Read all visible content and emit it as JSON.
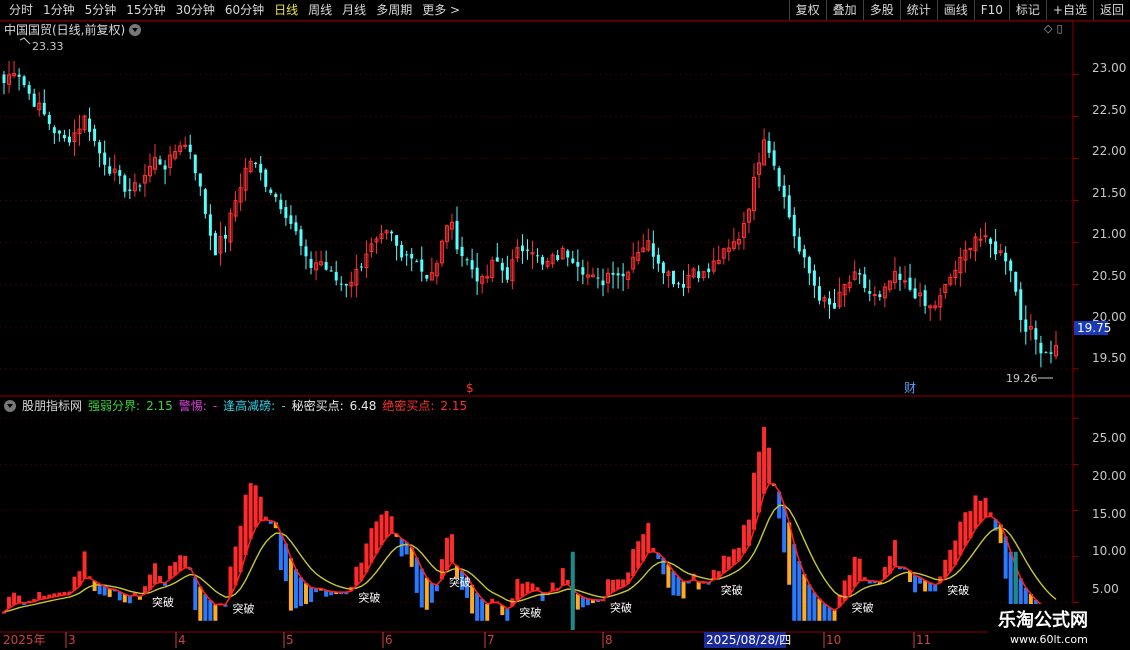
{
  "toolbar": {
    "periods": [
      "分时",
      "1分钟",
      "5分钟",
      "15分钟",
      "30分钟",
      "60分钟",
      "日线",
      "周线",
      "月线",
      "多周期",
      "更多 >"
    ],
    "active_period": "日线",
    "actions": [
      "复权",
      "叠加",
      "多股",
      "统计",
      "画线",
      "F10",
      "标记",
      "+自选",
      "返回"
    ]
  },
  "main_chart": {
    "title": "中国国贸(日线,前复权)",
    "high_label": "23.33",
    "low_label": "19.26",
    "current_price": "19.75",
    "y_ticks": [
      "23.00",
      "22.50",
      "22.00",
      "21.50",
      "21.00",
      "20.50",
      "20.00",
      "19.50"
    ],
    "ylim": [
      19.2,
      23.6
    ],
    "markers": {
      "dollar": "$",
      "cai": "财"
    }
  },
  "indicator": {
    "name": "股朋指标网",
    "fields": [
      {
        "label": "强弱分界:",
        "value": "2.15",
        "color": "#3cd23c"
      },
      {
        "label": "警惕:",
        "value": "-",
        "color": "#e040e0"
      },
      {
        "label": "逢高减磅:",
        "value": "-",
        "color": "#30d0e8"
      },
      {
        "label": "秘密买点:",
        "value": "6.48",
        "color": "#e8e8e8"
      },
      {
        "label": "绝密买点:",
        "value": "2.15",
        "color": "#ff3030"
      }
    ],
    "y_ticks": [
      "25.00",
      "20.00",
      "15.00",
      "10.00",
      "5.00"
    ],
    "ylim": [
      2.0,
      27.0
    ],
    "signal_text": "突破"
  },
  "date_axis": {
    "labels": [
      "2025年",
      "3",
      "4",
      "5",
      "6",
      "7",
      "8",
      "2025/08/28/四",
      "10",
      "11"
    ]
  },
  "watermark": {
    "line1": "乐淘公式网",
    "line2": "www.60lt.com"
  },
  "colors": {
    "up": "#ff3232",
    "down": "#54ffff",
    "grid": "#3a0000",
    "axis_border": "#8b0000"
  },
  "chart_data": {
    "type": "candlestick",
    "close_series": [
      22.9,
      23.1,
      22.8,
      22.6,
      22.4,
      22.2,
      22.3,
      22.5,
      22.1,
      21.9,
      21.7,
      21.6,
      21.8,
      22.0,
      21.9,
      22.2,
      22.1,
      21.5,
      20.9,
      21.1,
      21.6,
      22.0,
      21.8,
      21.6,
      21.4,
      21.1,
      20.7,
      20.8,
      20.6,
      20.5,
      20.6,
      20.9,
      21.0,
      21.1,
      20.8,
      20.9,
      20.6,
      20.7,
      21.3,
      20.9,
      20.7,
      20.5,
      20.8,
      20.6,
      20.9,
      21.0,
      20.7,
      20.8,
      20.9,
      20.8,
      20.6,
      20.5,
      20.7,
      20.6,
      20.9,
      21.0,
      20.8,
      20.6,
      20.5,
      20.7,
      20.6,
      20.8,
      20.9,
      21.1,
      21.6,
      22.3,
      21.9,
      21.4,
      20.9,
      20.6,
      20.3,
      20.2,
      20.5,
      20.6,
      20.4,
      20.3,
      20.6,
      20.5,
      20.4,
      20.2,
      20.3,
      20.6,
      20.8,
      21.1,
      21.0,
      20.9,
      20.8,
      20.1,
      19.9,
      19.7,
      19.75
    ]
  }
}
